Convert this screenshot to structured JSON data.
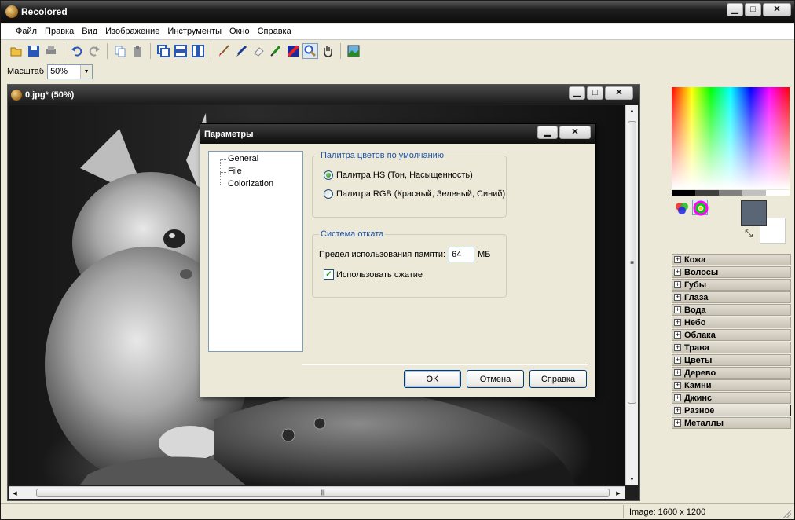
{
  "app": {
    "title": "Recolored",
    "window_buttons": {
      "minimize": "▁",
      "maximize": "□",
      "close": "✕"
    }
  },
  "menu": [
    "Файл",
    "Правка",
    "Вид",
    "Изображение",
    "Инструменты",
    "Окно",
    "Справка"
  ],
  "toolbar": {
    "tools": [
      {
        "name": "open-icon"
      },
      {
        "name": "save-icon"
      },
      {
        "name": "print-icon"
      },
      {
        "sep": true
      },
      {
        "name": "undo-icon"
      },
      {
        "name": "redo-icon"
      },
      {
        "sep": true
      },
      {
        "name": "copy-icon"
      },
      {
        "name": "paste-icon"
      },
      {
        "sep": true
      },
      {
        "name": "view-overlay-icon"
      },
      {
        "name": "view-split-horizontal-icon"
      },
      {
        "name": "view-split-vertical-icon"
      },
      {
        "sep": true
      },
      {
        "name": "brush-icon"
      },
      {
        "name": "pencil-icon"
      },
      {
        "name": "eraser-icon"
      },
      {
        "name": "eyedropper-icon"
      },
      {
        "name": "fill-color-icon"
      },
      {
        "name": "zoom-icon",
        "active": true
      },
      {
        "name": "hand-icon"
      },
      {
        "sep": true
      },
      {
        "name": "image-compare-icon"
      }
    ]
  },
  "zoom": {
    "label": "Масштаб",
    "value": "50%"
  },
  "document": {
    "title": "0.jpg* (50%)",
    "scroll_grip": "≡",
    "hscroll_grip": "|||"
  },
  "colors": {
    "foreground": "#5a6676",
    "background": "#ffffff"
  },
  "categories": [
    {
      "label": "Кожа"
    },
    {
      "label": "Волосы"
    },
    {
      "label": "Губы"
    },
    {
      "label": "Глаза"
    },
    {
      "label": "Вода"
    },
    {
      "label": "Небо"
    },
    {
      "label": "Облака"
    },
    {
      "label": "Трава"
    },
    {
      "label": "Цветы"
    },
    {
      "label": "Дерево"
    },
    {
      "label": "Камни"
    },
    {
      "label": "Джинс"
    },
    {
      "label": "Разное",
      "selected": true
    },
    {
      "label": "Металлы"
    }
  ],
  "status": {
    "image_size": "Image: 1600 x 1200"
  },
  "dialog": {
    "title": "Параметры",
    "tree": [
      "General",
      "File",
      "Colorization"
    ],
    "palette_group": {
      "legend": "Палитра цветов по умолчанию",
      "options": [
        {
          "label": "Палитра HS (Тон, Насыщенность)",
          "checked": true
        },
        {
          "label": "Палитра RGB (Красный, Зеленый, Синий)",
          "checked": false
        }
      ]
    },
    "undo_group": {
      "legend": "Система отката",
      "memory_label": "Предел использования памяти:",
      "memory_value": "64",
      "memory_unit": "МБ",
      "compression_label": "Использовать сжатие",
      "compression_checked": true
    },
    "buttons": {
      "ok": "OK",
      "cancel": "Отмена",
      "help": "Справка"
    }
  }
}
